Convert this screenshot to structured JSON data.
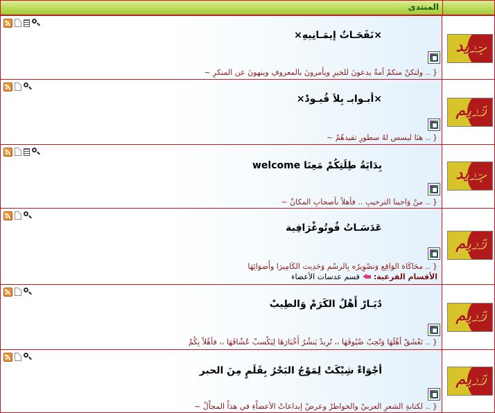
{
  "header": {
    "title": "المنتدى"
  },
  "forums": [
    {
      "badge": "جديد",
      "title": "×نَفَحَـاتٌ إيمَـانِيهِ×",
      "description": "{ .. ولتكنْ منكمْ أمةٌ يدعونَ للخيرِ ويأمرونَ بالمعروفِ وينهونَ عن المنكرِ ~"
    },
    {
      "badge": "قديم",
      "title": "×أبـوابـ بِلاَ قُيـودْ×",
      "description": "{ .. هنَا ليسس لهٌ سطورِ تقيدهُمْ ~"
    },
    {
      "badge": "جديد",
      "title": "بِدَايَةُ طِلَتِكُمْ مَعِنَا welcome",
      "description": "{ .. منْ وَاجبنا الترحيبِ .. فأهلاً بأصحابِ المكانْ ~"
    },
    {
      "badge": "قديم",
      "title": "عَدَسَـاتُ فُوتُوغْرَافِية",
      "description": "{ .. محَاكَاة الوَاقِع وَتصْوِيرُه بِالرسْم وَحَدِيث الكَامِيرَا وأَضوَائِهَا",
      "subforums_label": "الأقسام الفرعية:",
      "subforum": "قسم عدسات الأعضاء"
    },
    {
      "badge": "قديم",
      "title": "دُيَـارْ أَهْلُ الكَرَمْ وَالطِيبْ",
      "description": "{ .. تَعْشَقْ أهْلَهَا وَتُحِبّ ضُيُوفَهَا ،، تُرِيدْ يَنشُرُ أَخْبَارَهَا لِيَكْسبْ عُشّاقَهَا ،، فأهْلاً بِكُمْ"
    },
    {
      "badge": "قديم",
      "title": "أجْوَاءْ شِيْكَتْ لِمَوْجُ البَحْرُ بِقَلَمٍ مِنَ الحبر",
      "description": "{ .. لكتابةِ الشعرِ العربيْ والخواطرْ وعرضْ إبداعاتْ الأعضاْءِ في هذاْ المجاْلْ ~"
    }
  ]
}
